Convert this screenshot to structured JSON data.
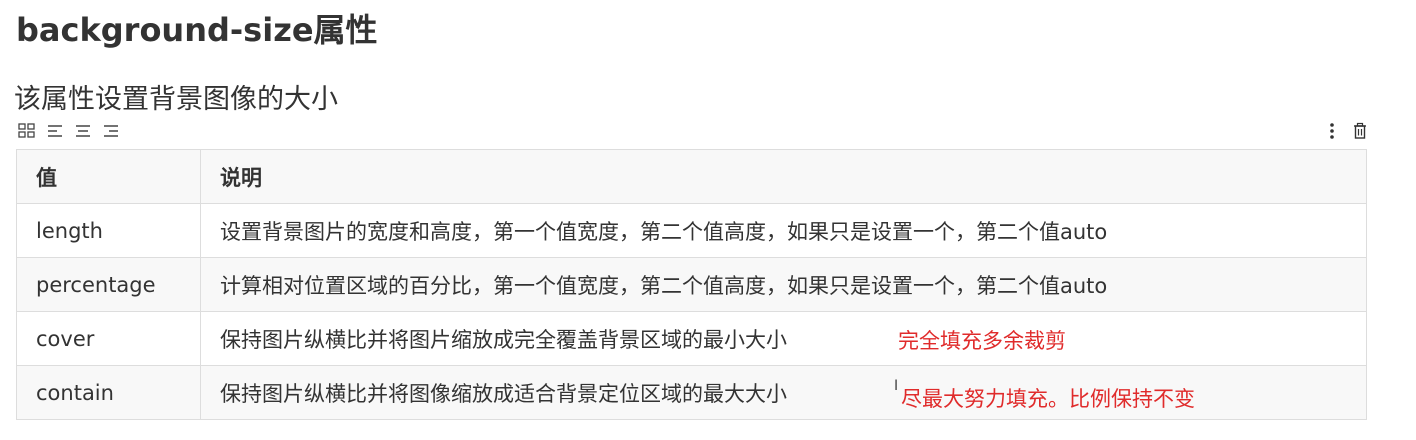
{
  "page": {
    "title": "background-size属性",
    "subtitle": "该属性设置背景图像的大小"
  },
  "toolbar": {
    "left_icons": [
      "grid-icon",
      "align-left-icon",
      "align-center-icon",
      "align-right-icon"
    ],
    "right_icons": [
      "more-vertical-icon",
      "trash-icon"
    ]
  },
  "table": {
    "headers": [
      "值",
      "说明"
    ],
    "rows": [
      {
        "value": "length",
        "desc": "设置背景图片的宽度和高度，第一个值宽度，第二个值高度，如果只是设置一个，第二个值auto",
        "note": ""
      },
      {
        "value": "percentage",
        "desc": "计算相对位置区域的百分比，第一个值宽度，第二个值高度，如果只是设置一个，第二个值auto",
        "note": ""
      },
      {
        "value": "cover",
        "desc": "保持图片纵横比并将图片缩放成完全覆盖背景区域的最小大小",
        "note": "完全填充多余裁剪"
      },
      {
        "value": "contain",
        "desc": "保持图片纵横比并将图像缩放成适合背景定位区域的最大大小",
        "note": "尽最大努力填充。比例保持不变"
      }
    ]
  },
  "colors": {
    "note": "#e02b2b",
    "border": "#dddddd",
    "header_bg": "#f8f8f8",
    "text": "#333333"
  }
}
